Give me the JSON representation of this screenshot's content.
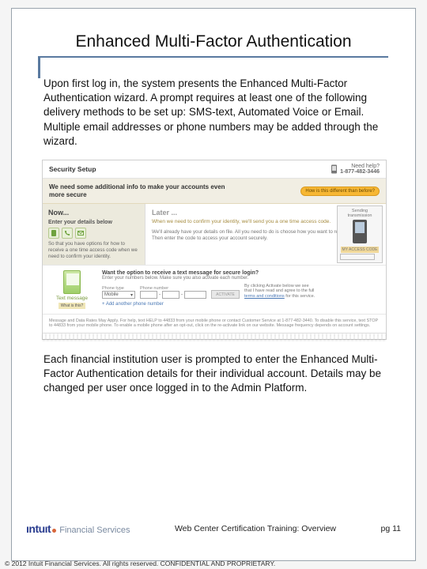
{
  "title": "Enhanced Multi-Factor Authentication",
  "para1": "Upon first log in, the system presents the Enhanced Multi-Factor Authentication wizard. A prompt requires at least one of the following delivery methods to be set up: SMS-text, Automated Voice or Email. Multiple email addresses or phone numbers may be added through the wizard.",
  "para2": "Each financial institution user is prompted to enter the Enhanced Multi-Factor Authentication details for their individual account. Details may be changed per user once logged in to the Admin Platform.",
  "shot": {
    "header": "Security Setup",
    "help_label": "Need help?",
    "help_phone": "1-877-482-3446",
    "banner": "We need some additional info to make your accounts even more secure",
    "banner_btn": "How is this different than before?",
    "now_title": "Now...",
    "now_sub": "Enter your details below",
    "now_desc": "So that you have options for how to receive a one time access code when we need to confirm your identity.",
    "later_title": "Later ...",
    "later_blurb": "When we need to confirm your identity, we'll send you a one time access code.",
    "later_blurb2": "We'll already have your details on file. All you need to do is choose how you want to receive the code. Then enter the code to access your account securely.",
    "device_sending": "Sending transmission",
    "device_access": "MY ACCESS CODE",
    "sec2_q": "Want the option to receive a text message for secure login?",
    "sec2_sub": "Enter your numbers below. Make sure you also activate each number.",
    "phone_type_hdr": "Phone type",
    "phone_num_hdr": "Phone number",
    "phone_type_val": "Mobile",
    "text_msg_lbl": "Text message",
    "what_is": "What is this?",
    "activate_note": "By clicking Activate below we see that I have read and agree to the full",
    "activate_link": "terms and conditions",
    "activate_suffix": "for this service.",
    "add_link": "+ Add another phone number",
    "footnote": "Message and Data Rates May Apply. For help, text HELP to 44833 from your mobile phone or contact Customer Service at 1-877-482-3440. To disable this service, text STOP to 44833 from your mobile phone. To enable a mobile phone after an opt-out, click on the re-activate link on our website. Message frequency depends on account settings."
  },
  "footer": {
    "logo_main": "ıntuıt",
    "logo_sub": "Financial Services",
    "mid": "Web Center Certification Training: Overview",
    "page": "pg 11"
  },
  "copyright": "© 2012 Intuit Financial Services. All rights reserved. CONFIDENTIAL AND PROPRIETARY."
}
